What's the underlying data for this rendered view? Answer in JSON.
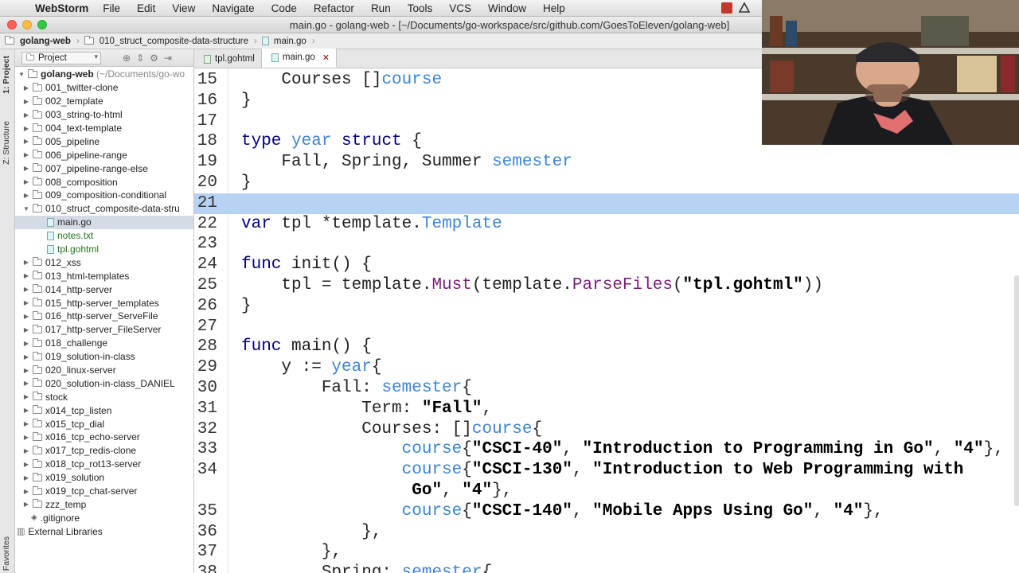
{
  "menubar": {
    "app_name": "WebStorm",
    "items": [
      "File",
      "Edit",
      "View",
      "Navigate",
      "Code",
      "Refactor",
      "Run",
      "Tools",
      "VCS",
      "Window",
      "Help"
    ]
  },
  "window": {
    "title": "main.go - golang-web - [~/Documents/go-workspace/src/github.com/GoesToEleven/golang-web]"
  },
  "breadcrumb": [
    "golang-web",
    "010_struct_composite-data-structure",
    "main.go"
  ],
  "toolstrip": {
    "project_tab": "1: Project",
    "structure_tab": "Z: Structure",
    "favorites_tab": "Favorites"
  },
  "project_panel": {
    "view_selector": "Project",
    "root": {
      "name": "golang-web",
      "path": "(~/Documents/go-wo"
    },
    "items": [
      {
        "label": "001_twitter-clone",
        "kind": "folder",
        "expanded": false
      },
      {
        "label": "002_template",
        "kind": "folder",
        "expanded": false
      },
      {
        "label": "003_string-to-html",
        "kind": "folder",
        "expanded": false
      },
      {
        "label": "004_text-template",
        "kind": "folder",
        "expanded": false
      },
      {
        "label": "005_pipeline",
        "kind": "folder",
        "expanded": false
      },
      {
        "label": "006_pipeline-range",
        "kind": "folder",
        "expanded": false
      },
      {
        "label": "007_pipeline-range-else",
        "kind": "folder",
        "expanded": false
      },
      {
        "label": "008_composition",
        "kind": "folder",
        "expanded": false
      },
      {
        "label": "009_composition-conditional",
        "kind": "folder",
        "expanded": false
      },
      {
        "label": "010_struct_composite-data-stru",
        "kind": "folder",
        "expanded": true
      },
      {
        "label": "main.go",
        "kind": "file",
        "child": true,
        "selected": true
      },
      {
        "label": "notes.txt",
        "kind": "file",
        "child": true,
        "green": true
      },
      {
        "label": "tpl.gohtml",
        "kind": "file",
        "child": true,
        "green": true
      },
      {
        "label": "012_xss",
        "kind": "folder",
        "expanded": false
      },
      {
        "label": "013_html-templates",
        "kind": "folder",
        "expanded": false
      },
      {
        "label": "014_http-server",
        "kind": "folder",
        "expanded": false
      },
      {
        "label": "015_http-server_templates",
        "kind": "folder",
        "expanded": false
      },
      {
        "label": "016_http-server_ServeFile",
        "kind": "folder",
        "expanded": false
      },
      {
        "label": "017_http-server_FileServer",
        "kind": "folder",
        "expanded": false
      },
      {
        "label": "018_challenge",
        "kind": "folder",
        "expanded": false
      },
      {
        "label": "019_solution-in-class",
        "kind": "folder",
        "expanded": false
      },
      {
        "label": "020_linux-server",
        "kind": "folder",
        "expanded": false
      },
      {
        "label": "020_solution-in-class_DANIEL",
        "kind": "folder",
        "expanded": false
      },
      {
        "label": "stock",
        "kind": "folder",
        "expanded": false
      },
      {
        "label": "x014_tcp_listen",
        "kind": "folder",
        "expanded": false
      },
      {
        "label": "x015_tcp_dial",
        "kind": "folder",
        "expanded": false
      },
      {
        "label": "x016_tcp_echo-server",
        "kind": "folder",
        "expanded": false
      },
      {
        "label": "x017_tcp_redis-clone",
        "kind": "folder",
        "expanded": false
      },
      {
        "label": "x018_tcp_rot13-server",
        "kind": "folder",
        "expanded": false
      },
      {
        "label": "x019_solution",
        "kind": "folder",
        "expanded": false
      },
      {
        "label": "x019_tcp_chat-server",
        "kind": "folder",
        "expanded": false
      },
      {
        "label": "zzz_temp",
        "kind": "folder",
        "expanded": false
      },
      {
        "label": ".gitignore",
        "kind": "gitfile"
      },
      {
        "label": "External Libraries",
        "kind": "libs",
        "top": true
      }
    ]
  },
  "editor_tabs": [
    {
      "label": "tpl.gohtml",
      "active": false
    },
    {
      "label": "main.go",
      "active": true
    }
  ],
  "editor": {
    "current_line": "21",
    "lines": [
      {
        "n": "15",
        "tokens": [
          [
            "    Courses []",
            "p"
          ],
          [
            "course",
            "tp"
          ]
        ]
      },
      {
        "n": "16",
        "tokens": [
          [
            "}",
            "p"
          ]
        ]
      },
      {
        "n": "17",
        "tokens": []
      },
      {
        "n": "18",
        "tokens": [
          [
            "type ",
            "kw"
          ],
          [
            "year ",
            "tp"
          ],
          [
            "struct",
            "kw"
          ],
          [
            " {",
            "p"
          ]
        ]
      },
      {
        "n": "19",
        "tokens": [
          [
            "    Fall, Spring, Summer ",
            "p"
          ],
          [
            "semester",
            "tp"
          ]
        ]
      },
      {
        "n": "20",
        "tokens": [
          [
            "}",
            "p"
          ]
        ]
      },
      {
        "n": "21",
        "tokens": []
      },
      {
        "n": "22",
        "tokens": [
          [
            "var ",
            "kw"
          ],
          [
            "tpl *template.",
            "p"
          ],
          [
            "Template",
            "tp"
          ]
        ]
      },
      {
        "n": "23",
        "tokens": []
      },
      {
        "n": "24",
        "tokens": [
          [
            "func ",
            "kw"
          ],
          [
            "init",
            "fnb"
          ],
          [
            "() {",
            "p"
          ]
        ]
      },
      {
        "n": "25",
        "tokens": [
          [
            "    tpl = template.",
            "p"
          ],
          [
            "Must",
            "fn"
          ],
          [
            "(template.",
            "p"
          ],
          [
            "ParseFiles",
            "fn"
          ],
          [
            "(",
            "p"
          ],
          [
            "\"tpl.gohtml\"",
            "str"
          ],
          [
            "))",
            "p"
          ]
        ]
      },
      {
        "n": "26",
        "tokens": [
          [
            "}",
            "p"
          ]
        ]
      },
      {
        "n": "27",
        "tokens": []
      },
      {
        "n": "28",
        "tokens": [
          [
            "func ",
            "kw"
          ],
          [
            "main",
            "fnb"
          ],
          [
            "() {",
            "p"
          ]
        ]
      },
      {
        "n": "29",
        "tokens": [
          [
            "    y := ",
            "p"
          ],
          [
            "year",
            "tp"
          ],
          [
            "{",
            "p"
          ]
        ]
      },
      {
        "n": "30",
        "tokens": [
          [
            "        Fall: ",
            "p"
          ],
          [
            "semester",
            "tp"
          ],
          [
            "{",
            "p"
          ]
        ]
      },
      {
        "n": "31",
        "tokens": [
          [
            "            Term: ",
            "p"
          ],
          [
            "\"Fall\"",
            "str"
          ],
          [
            ",",
            "p"
          ]
        ]
      },
      {
        "n": "32",
        "tokens": [
          [
            "            Courses: []",
            "p"
          ],
          [
            "course",
            "tp"
          ],
          [
            "{",
            "p"
          ]
        ]
      },
      {
        "n": "33",
        "tokens": [
          [
            "                ",
            "p"
          ],
          [
            "course",
            "tp"
          ],
          [
            "{",
            "p"
          ],
          [
            "\"CSCI-40\"",
            "str"
          ],
          [
            ", ",
            "p"
          ],
          [
            "\"Introduction to Programming in Go\"",
            "str"
          ],
          [
            ", ",
            "p"
          ],
          [
            "\"4\"",
            "str"
          ],
          [
            "},",
            "p"
          ]
        ]
      },
      {
        "n": "34",
        "tokens": [
          [
            "                ",
            "p"
          ],
          [
            "course",
            "tp"
          ],
          [
            "{",
            "p"
          ],
          [
            "\"CSCI-130\"",
            "str"
          ],
          [
            ", ",
            "p"
          ],
          [
            "\"Introduction to Web Programming with",
            "str"
          ]
        ]
      },
      {
        "n": "",
        "tokens": [
          [
            "                 ",
            "p"
          ],
          [
            "Go\"",
            "str"
          ],
          [
            ", ",
            "p"
          ],
          [
            "\"4\"",
            "str"
          ],
          [
            "},",
            "p"
          ]
        ]
      },
      {
        "n": "35",
        "tokens": [
          [
            "                ",
            "p"
          ],
          [
            "course",
            "tp"
          ],
          [
            "{",
            "p"
          ],
          [
            "\"CSCI-140\"",
            "str"
          ],
          [
            ", ",
            "p"
          ],
          [
            "\"Mobile Apps Using Go\"",
            "str"
          ],
          [
            ", ",
            "p"
          ],
          [
            "\"4\"",
            "str"
          ],
          [
            "},",
            "p"
          ]
        ]
      },
      {
        "n": "36",
        "tokens": [
          [
            "            },",
            "p"
          ]
        ]
      },
      {
        "n": "37",
        "tokens": [
          [
            "        },",
            "p"
          ]
        ]
      },
      {
        "n": "38",
        "tokens": [
          [
            "        Spring: ",
            "p"
          ],
          [
            "semester",
            "tp"
          ],
          [
            "{",
            "p"
          ]
        ]
      }
    ]
  },
  "colors": {
    "keyword": "#000080",
    "type": "#3d84d6",
    "function": "#7a1e7a",
    "current_line_bg": "#b8d2f3",
    "selected_row_bg": "#d5dbe5"
  }
}
